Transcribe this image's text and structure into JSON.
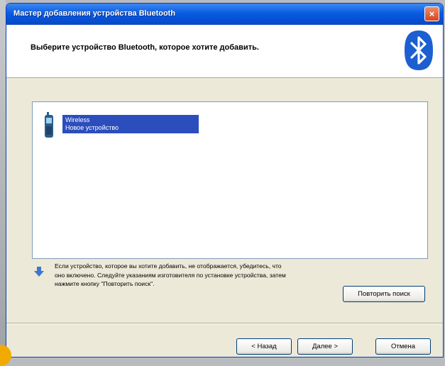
{
  "window": {
    "title": "Мастер добавления устройства Bluetooth",
    "close_glyph": "×"
  },
  "header": {
    "text": "Выберите устройство Bluetooth, которое хотите добавить.",
    "logo_icon": "bluetooth-icon"
  },
  "device_list": {
    "items": [
      {
        "icon": "phone-icon",
        "name": "Wireless",
        "type": "Новое устройство"
      }
    ]
  },
  "hint": {
    "icon": "down-arrow-icon",
    "text": "Если устройство, которое вы хотите добавить, не отображается, убедитесь, что оно включено. Следуйте указаниям изготовителя по установке устройства, затем нажмите кнопку \"Повторить поиск\"."
  },
  "buttons": {
    "repeat_search": "Повторить поиск",
    "back": "< Назад",
    "next": "Далее >",
    "cancel": "Отмена"
  },
  "colors": {
    "titlebar": "#0a5ce0",
    "selection": "#2c4ebd",
    "bluetooth": "#1c5fd1"
  }
}
